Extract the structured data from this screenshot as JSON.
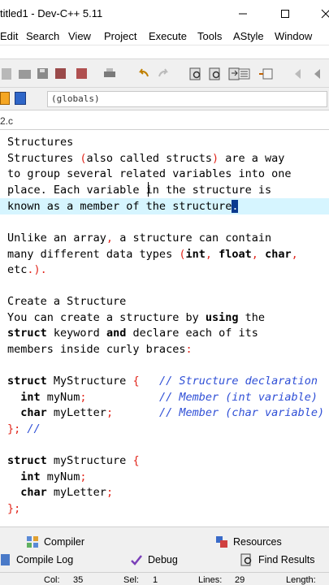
{
  "window": {
    "title": "titled1 - Dev-C++ 5.11"
  },
  "menu": [
    "Edit",
    "Search",
    "View",
    "Project",
    "Execute",
    "Tools",
    "AStyle",
    "Window"
  ],
  "scope": "(globals)",
  "tab": {
    "label": "2.c"
  },
  "editor": {
    "lines": {
      "l1": "Structures",
      "l2a": "Structures ",
      "l2b": "(",
      "l2c": "also called structs",
      "l2d": ")",
      "l2e": " are a way",
      "l3": "to group several related variables into one",
      "l4": "place. Each variable in the structure is",
      "l5a": "known as a member of the structure",
      "l5b": ".",
      "l7a": "Unlike an array",
      "l7b": ",",
      "l7c": " a structure can contain",
      "l8a": "many different data types ",
      "l8b": "(",
      "l8c": "int",
      "l8d": ",",
      "l8e": " ",
      "l8f": "float",
      "l8g": ",",
      "l8h": " ",
      "l8i": "char",
      "l8j": ",",
      "l9a": "etc",
      "l9b": ".).",
      "l11": "Create a Structure",
      "l12a": "You can create a structure by ",
      "l12b": "using",
      "l12c": " the",
      "l13a": "struct",
      "l13b": " keyword ",
      "l13c": "and",
      "l13d": " declare each of its",
      "l14a": "members inside curly braces",
      "l14b": ":",
      "l16a": "struct",
      "l16b": " MyStructure ",
      "l16c": "{",
      "l16d": "   // Structure declaration",
      "l17a": "  int",
      "l17b": " myNum",
      "l17c": ";",
      "l17d": "           // Member (int variable)",
      "l18a": "  char",
      "l18b": " myLetter",
      "l18c": ";",
      "l18d": "       // Member (char variable)",
      "l19a": "}",
      "l19b": ";",
      "l19c": " //",
      "l21a": "struct",
      "l21b": " myStructure ",
      "l21c": "{",
      "l22a": "  int",
      "l22b": " myNum",
      "l22c": ";",
      "l23a": "  char",
      "l23b": " myLetter",
      "l23c": ";",
      "l24a": "}",
      "l24b": ";"
    }
  },
  "bottom": {
    "compiler": "Compiler",
    "resources": "Resources",
    "compile_log": "Compile Log",
    "debug": "Debug",
    "find_results": "Find Results"
  },
  "status": {
    "col_label": "Col:",
    "col_value": "35",
    "sel_label": "Sel:",
    "sel_value": "1",
    "lines_label": "Lines:",
    "lines_value": "29",
    "length_label": "Length:"
  },
  "colors": {
    "keyword": "#000000",
    "symbol": "#e1261c",
    "comment": "#2f4fd6",
    "current_line": "#d6f5ff"
  }
}
